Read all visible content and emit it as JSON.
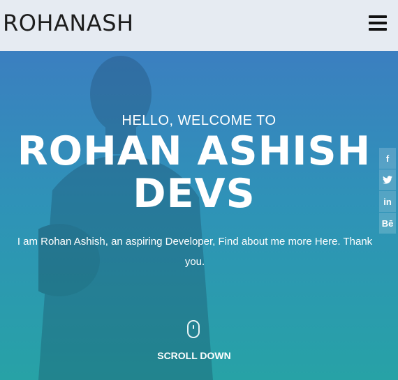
{
  "header": {
    "brand": "ROHANASH",
    "menu_icon": "hamburger-menu-icon"
  },
  "hero": {
    "greeting": "HELLO, WELCOME TO",
    "title_line1": "ROHAN ASHISH",
    "title_line2": "DEVS",
    "subtitle": "I am Rohan Ashish, an aspiring Developer, Find about me more Here. Thank you.",
    "scroll_label": "SCROLL DOWN",
    "scroll_icon": "mouse-scroll-icon",
    "gradient_colors": [
      "#3b7fc0",
      "#27a2a6"
    ]
  },
  "social": [
    {
      "icon": "facebook-icon",
      "glyph": "f"
    },
    {
      "icon": "twitter-icon",
      "glyph": "t"
    },
    {
      "icon": "linkedin-icon",
      "glyph": "in"
    },
    {
      "icon": "behance-icon",
      "glyph": "Bē"
    }
  ]
}
